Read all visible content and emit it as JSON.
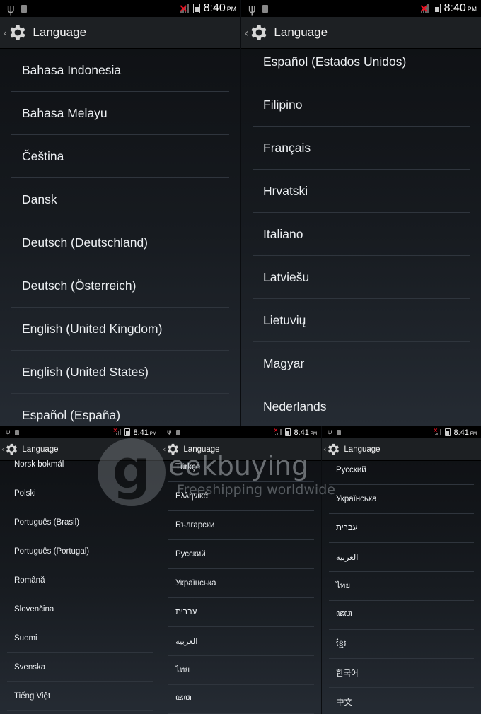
{
  "status_bar": {
    "top_time": "8:40",
    "bottom_time": "8:41",
    "ampm": "PM"
  },
  "action_bar": {
    "title": "Language"
  },
  "panels": {
    "top_left": [
      "Bahasa Indonesia",
      "Bahasa Melayu",
      "Čeština",
      "Dansk",
      "Deutsch (Deutschland)",
      "Deutsch (Österreich)",
      "English (United Kingdom)",
      "English (United States)",
      "Español (España)"
    ],
    "top_right": [
      "Español (Estados Unidos)",
      "Filipino",
      "Français",
      "Hrvatski",
      "Italiano",
      "Latviešu",
      "Lietuvių",
      "Magyar",
      "Nederlands"
    ],
    "bottom_left": [
      "Norsk bokmål",
      "Polski",
      "Português (Brasil)",
      "Português (Portugal)",
      "Română",
      "Slovenčina",
      "Suomi",
      "Svenska",
      "Tiếng Việt"
    ],
    "bottom_mid": [
      "Türkçe",
      "Ελληνικά",
      "Български",
      "Русский",
      "Українська",
      "עברית",
      "العربية",
      "ไทย",
      "ꦗꦮ"
    ],
    "bottom_right": [
      "Русский",
      "Українська",
      "עברית",
      "العربية",
      "ไทย",
      "ꦗꦮ",
      "ខ្មែរ",
      "한국어",
      "中文"
    ]
  },
  "watermark": {
    "brand": "eekbuying",
    "tagline": "Freeshipping worldwide"
  },
  "colors": {
    "background_top": "#0d0f12",
    "background_bottom": "#252b33",
    "divider": "#2f353d",
    "actionbar": "#1d2023",
    "signal_x": "#ee1122"
  }
}
